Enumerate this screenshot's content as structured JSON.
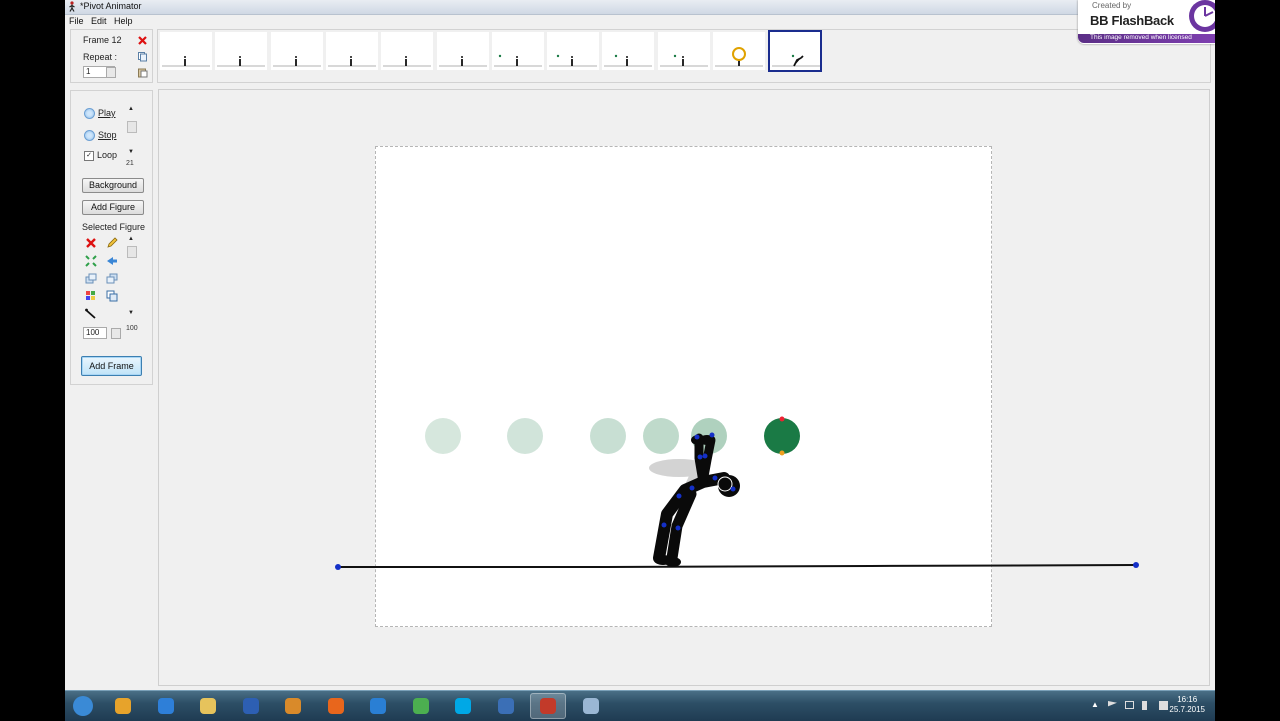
{
  "window": {
    "title": "*Pivot Animator"
  },
  "menu": {
    "file": "File",
    "edit": "Edit",
    "help": "Help"
  },
  "branding": {
    "created_by": "Created by",
    "name": "BB FlashBack",
    "notice": "This image removed when licensed"
  },
  "frame_info": {
    "frame_label": "Frame 12",
    "repeat_label": "Repeat :",
    "repeat_value": "1"
  },
  "timeline": {
    "frame_count": 12,
    "selected_frame": 12
  },
  "controls": {
    "play": "Play",
    "stop": "Stop",
    "loop": "Loop",
    "loop_checked": true,
    "speed_value": "21",
    "background_btn": "Background",
    "add_figure_btn": "Add Figure",
    "selected_figure_label": "Selected Figure",
    "size_value": "100",
    "size_slider_value": "100",
    "add_frame_btn": "Add Frame"
  },
  "icons": {
    "app": "stickman-icon",
    "delete_frame": "close-icon",
    "copy_frame": "copy-icon",
    "paste_frame": "paste-icon",
    "delete_figure": "delete-icon",
    "edit_figure": "pencil-icon",
    "center_figure": "center-icon",
    "flip_figure": "flip-icon",
    "color_figure": "color-icon",
    "line_tool": "line-tool-icon"
  },
  "colors": {
    "ball": "#1a7a45",
    "ball_onion": "#7fbf9b",
    "stickman": "#0a0a0a",
    "joint": "#1430c8",
    "selected_border": "#1a2c8e"
  },
  "taskbar": {
    "apps": [
      "start",
      "media-player",
      "shield",
      "explorer",
      "word",
      "cat",
      "firefox",
      "internet-explorer",
      "chrome",
      "skype",
      "network",
      "pivot",
      "window"
    ],
    "active_app": "pivot",
    "time": "16:16",
    "date": "25.7.2015"
  }
}
